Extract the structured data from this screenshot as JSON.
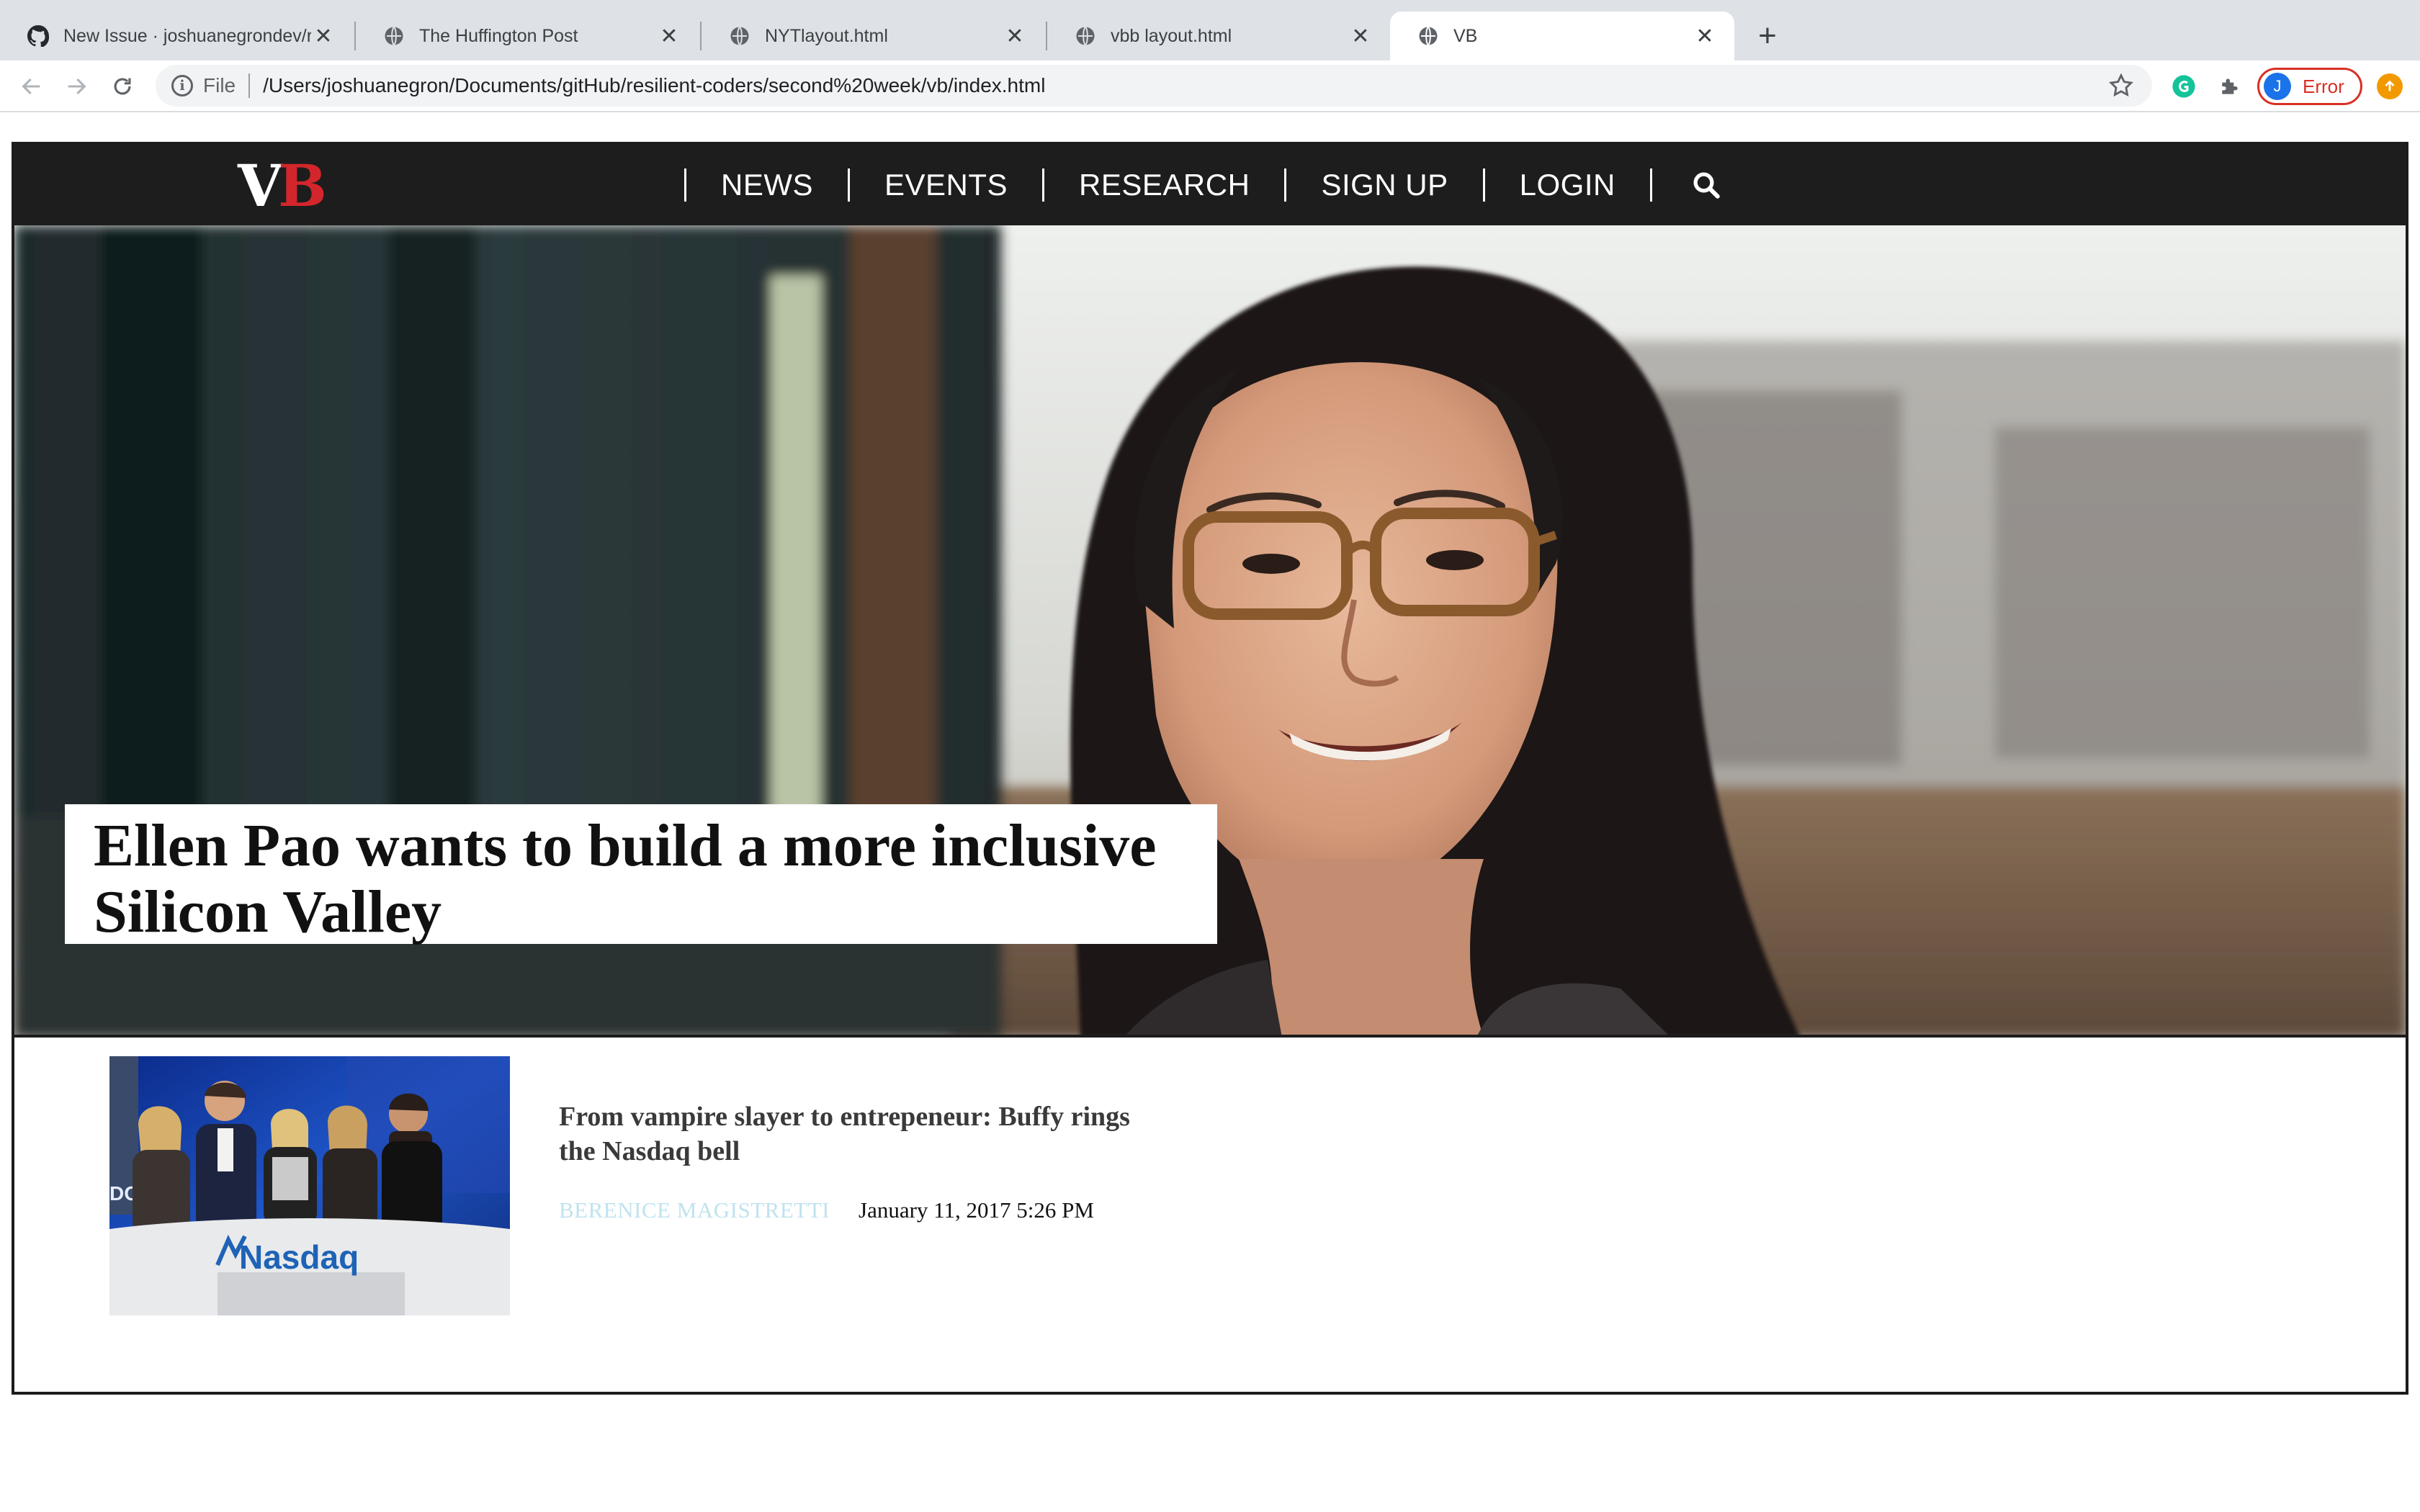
{
  "browser": {
    "tabs": [
      {
        "title": "New Issue · joshuanegrondev/r",
        "icon": "github-icon"
      },
      {
        "title": "The Huffington Post",
        "icon": "globe-icon"
      },
      {
        "title": "NYTlayout.html",
        "icon": "globe-icon"
      },
      {
        "title": "vbb layout.html",
        "icon": "globe-icon"
      },
      {
        "title": "VB",
        "icon": "globe-icon",
        "active": true
      }
    ],
    "omnibox": {
      "scheme_label": "File",
      "url": "/Users/joshuanegron/Documents/gitHub/resilient-coders/second%20week/vb/index.html"
    },
    "profile": {
      "initial": "J",
      "status": "Error"
    },
    "colors": {
      "tabstrip": "#dee1e6",
      "error": "#d93025",
      "avatar": "#1a73e8",
      "update": "#f29900"
    }
  },
  "site": {
    "logo": {
      "v": "V",
      "b": "B"
    },
    "nav": [
      "NEWS",
      "EVENTS",
      "RESEARCH",
      "SIGN UP",
      "LOGIN"
    ],
    "hero": {
      "headline": "Ellen Pao wants to build a more inclusive Silicon Valley"
    },
    "story": {
      "title": "From vampire slayer to entrepeneur: Buffy rings the Nasdaq bell",
      "author": "BERENICE MAGISTRETTI",
      "date": "January 11, 2017 5:26 PM",
      "thumb_sign": "Nasdaq",
      "thumb_edge": "DO"
    },
    "colors": {
      "header": "#1d1d1d",
      "logo_red": "#d3262c",
      "author": "#bfe3ef"
    }
  }
}
